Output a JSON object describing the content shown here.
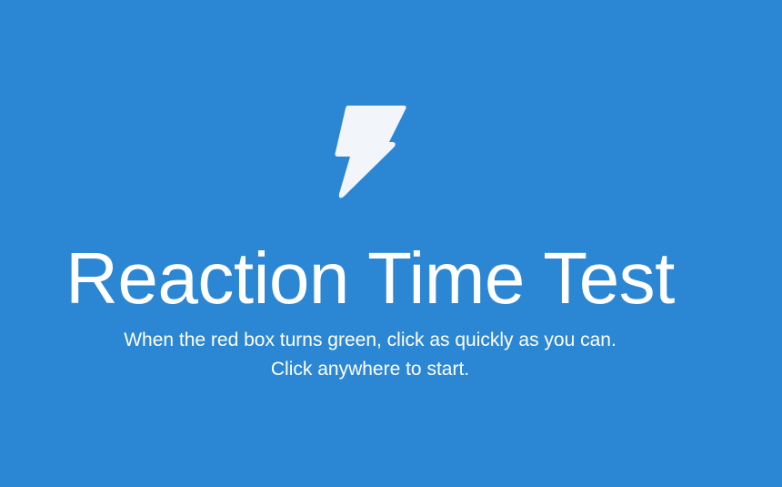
{
  "app": {
    "title": "Reaction Time Test",
    "icon": "lightning-bolt-icon",
    "instructions": {
      "line1": "When the red box turns green, click as quickly as you can.",
      "line2": "Click anywhere to start."
    },
    "colors": {
      "background": "#2b87d3",
      "text": "#ffffff",
      "icon": "#f2f6fb"
    }
  }
}
